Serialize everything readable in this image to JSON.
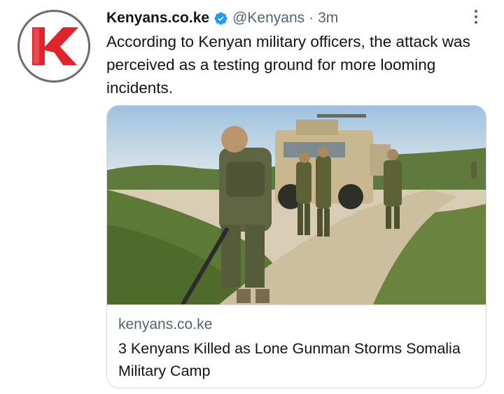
{
  "tweet": {
    "display_name": "Kenyans.co.ke",
    "handle": "@Kenyans",
    "separator": "·",
    "time": "3m",
    "text": "According to Kenyan military officers, the attack was perceived as a testing ground for more looming incidents.",
    "verified": true,
    "avatar_icon": "kenyans-logo-icon",
    "more_icon": "more-options-icon"
  },
  "card": {
    "image_description_icon": "photo",
    "domain": "kenyans.co.ke",
    "title": "3 Kenyans Killed as Lone Gunman Storms Somalia Military Camp"
  },
  "colors": {
    "brand_red": "#e0242b",
    "verified_blue": "#1d9bf0",
    "secondary_text": "#536471",
    "border": "#cfd9de"
  }
}
